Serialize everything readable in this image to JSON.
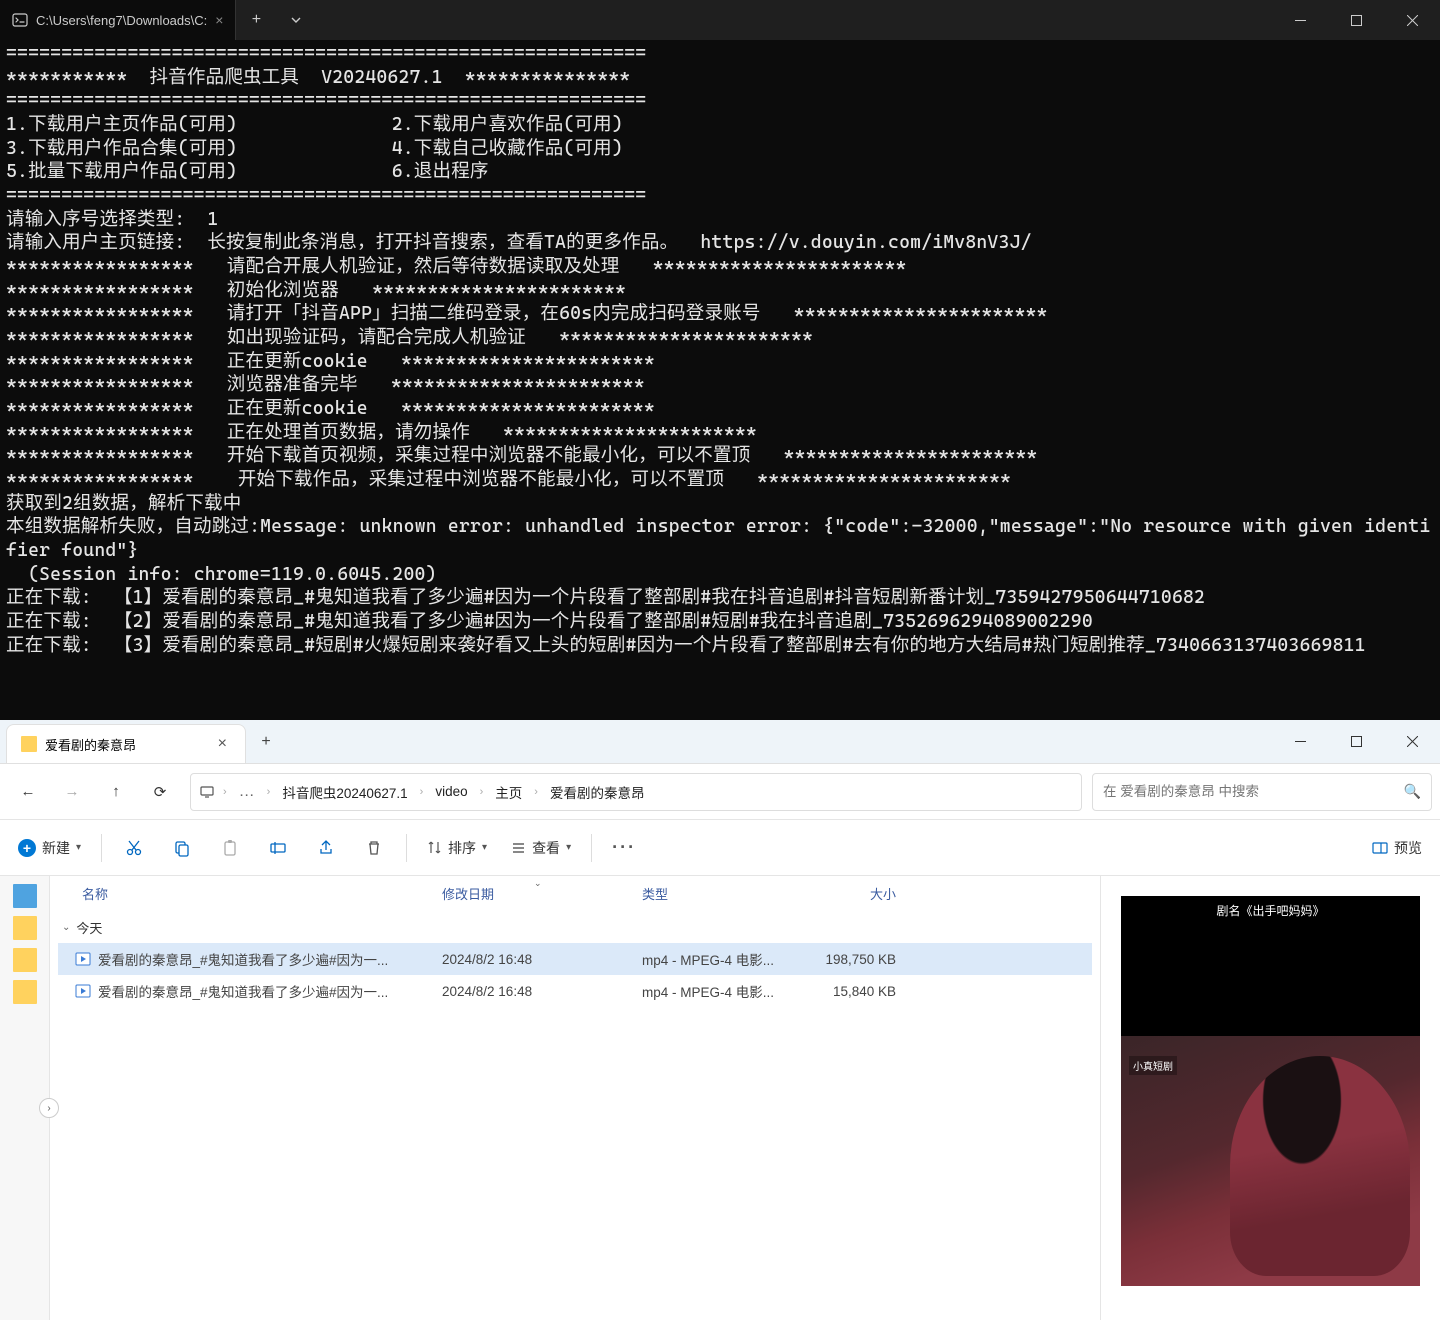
{
  "terminal": {
    "tab_title": "C:\\Users\\feng7\\Downloads\\C:",
    "lines": [
      "==========================================================",
      "***********  抖音作品爬虫工具  V20240627.1  ***************",
      "==========================================================",
      "1.下载用户主页作品(可用)              2.下载用户喜欢作品(可用)",
      "3.下载用户作品合集(可用)              4.下载自己收藏作品(可用)",
      "5.批量下载用户作品(可用)              6.退出程序",
      "==========================================================",
      "请输入序号选择类型:  1",
      "请输入用户主页链接:  长按复制此条消息，打开抖音搜索，查看TA的更多作品。  https://v.douyin.com/iMv8nV3J/",
      "*****************   请配合开展人机验证，然后等待数据读取及处理   ***********************",
      "*****************   初始化浏览器   ***********************",
      "*****************   请打开「抖音APP」扫描二维码登录，在60s内完成扫码登录账号   ***********************",
      "*****************   如出现验证码，请配合完成人机验证   ***********************",
      "*****************   正在更新cookie   ***********************",
      "*****************   浏览器准备完毕   ***********************",
      "*****************   正在更新cookie   ***********************",
      "*****************   正在处理首页数据，请勿操作   ***********************",
      "*****************   开始下载首页视频，采集过程中浏览器不能最小化，可以不置顶   ***********************",
      "*****************    开始下载作品，采集过程中浏览器不能最小化，可以不置顶   ***********************",
      "获取到2组数据，解析下载中",
      "本组数据解析失败，自动跳过:Message: unknown error: unhandled inspector error: {\"code\":-32000,\"message\":\"No resource with given identifier found\"}",
      "  (Session info: chrome=119.0.6045.200)",
      "",
      "正在下载:  【1】爱看剧的秦意昂_#鬼知道我看了多少遍#因为一个片段看了整部剧#我在抖音追剧#抖音短剧新番计划_7359427950644710682",
      "正在下载:  【2】爱看剧的秦意昂_#鬼知道我看了多少遍#因为一个片段看了整部剧#短剧#我在抖音追剧_7352696294089002290",
      "正在下载:  【3】爱看剧的秦意昂_#短剧#火爆短剧来袭好看又上头的短剧#因为一个片段看了整部剧#去有你的地方大结局#热门短剧推荐_7340663137403669811"
    ]
  },
  "explorer": {
    "tab_title": "爱看剧的秦意昂",
    "breadcrumb": [
      "抖音爬虫20240627.1",
      "video",
      "主页",
      "爱看剧的秦意昂"
    ],
    "search_placeholder": "在 爱看剧的秦意昂 中搜索",
    "toolbar": {
      "new_label": "新建",
      "sort_label": "排序",
      "view_label": "查看",
      "preview_label": "预览"
    },
    "columns": {
      "name": "名称",
      "date": "修改日期",
      "type": "类型",
      "size": "大小"
    },
    "group_label": "今天",
    "files": [
      {
        "name": "爱看剧的秦意昂_#鬼知道我看了多少遍#因为一...",
        "date": "2024/8/2 16:48",
        "type": "mp4 - MPEG-4 电影...",
        "size": "198,750 KB",
        "selected": true
      },
      {
        "name": "爱看剧的秦意昂_#鬼知道我看了多少遍#因为一...",
        "date": "2024/8/2 16:48",
        "type": "mp4 - MPEG-4 电影...",
        "size": "15,840 KB",
        "selected": false
      }
    ],
    "preview": {
      "title": "剧名《出手吧妈妈》",
      "label": "小真短剧"
    }
  }
}
